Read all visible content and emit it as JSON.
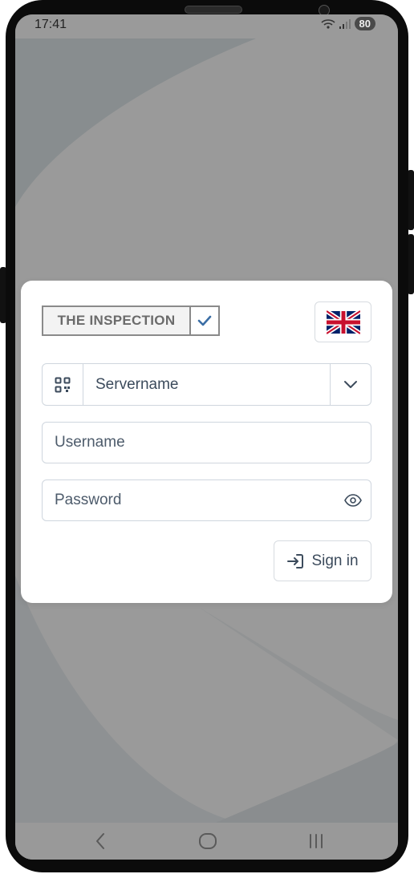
{
  "status_bar": {
    "time": "17:41",
    "battery": "80",
    "icons": [
      "wifi-icon",
      "signal-icon"
    ]
  },
  "login_card": {
    "logo_text": "THE INSPECTION",
    "language_flag": "uk-flag-icon",
    "server": {
      "label": "Servername",
      "qr_icon": "qr-code-icon",
      "dropdown_icon": "chevron-down-icon"
    },
    "username": {
      "placeholder": "Username",
      "value": ""
    },
    "password": {
      "placeholder": "Password",
      "value": "",
      "toggle_icon": "eye-icon"
    },
    "sign_in_label": "Sign in",
    "sign_in_icon": "sign-in-icon"
  },
  "nav_bar": {
    "items": [
      "back-icon",
      "home-icon",
      "recents-icon"
    ]
  },
  "colors": {
    "background": "#9a9a9a",
    "card": "#ffffff",
    "text": "#3c4b5c",
    "border": "#cfd6de",
    "accent_check": "#3b6ea5"
  }
}
